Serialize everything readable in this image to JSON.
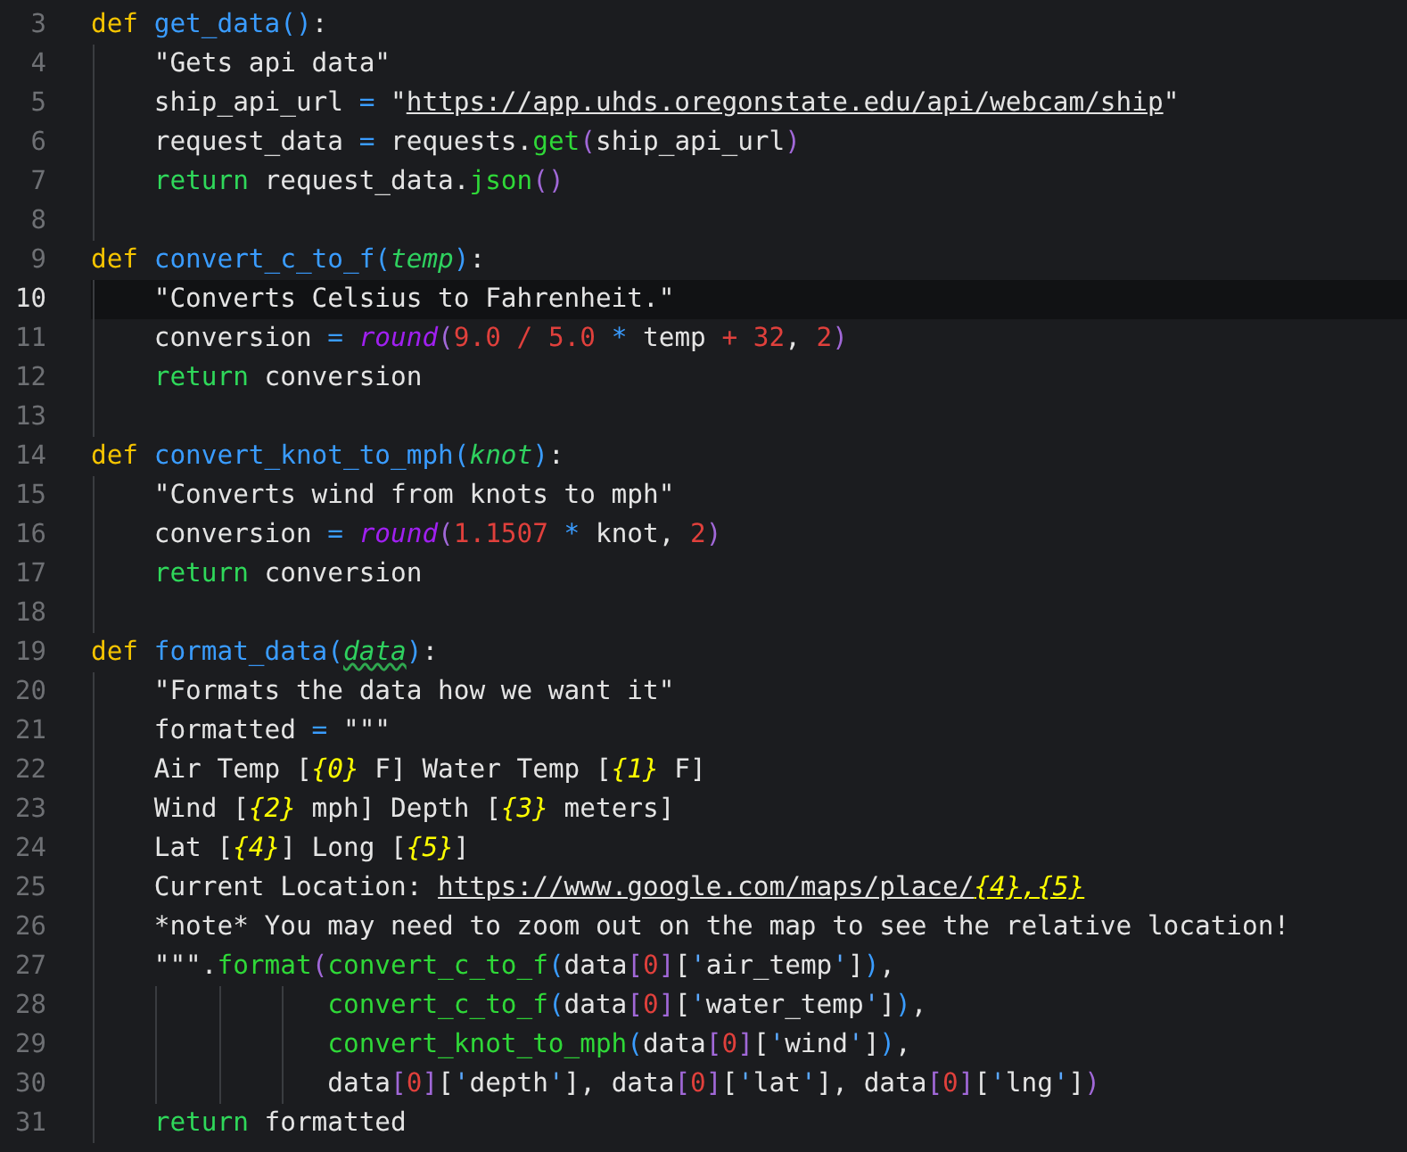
{
  "editor": {
    "lines": [
      {
        "number": "3",
        "current": false,
        "tokens": [
          {
            "kind": "keyword",
            "text": "def "
          },
          {
            "kind": "function",
            "text": "get_data"
          },
          {
            "kind": "paren",
            "text": "()"
          },
          {
            "kind": "plain",
            "text": ":"
          }
        ]
      },
      {
        "number": "4",
        "current": false,
        "tokens": [
          {
            "kind": "string",
            "text": "    \"Gets api data\""
          }
        ]
      },
      {
        "number": "5",
        "current": false,
        "tokens": [
          {
            "kind": "plain",
            "text": "    ship_api_url "
          },
          {
            "kind": "operator",
            "text": "="
          },
          {
            "kind": "string",
            "text": " \""
          },
          {
            "kind": "link",
            "text": "https://app.uhds.oregonstate.edu/api/webcam/ship"
          },
          {
            "kind": "string",
            "text": "\""
          }
        ]
      },
      {
        "number": "6",
        "current": false,
        "tokens": [
          {
            "kind": "plain",
            "text": "    request_data "
          },
          {
            "kind": "operator",
            "text": "="
          },
          {
            "kind": "plain",
            "text": " requests."
          },
          {
            "kind": "method",
            "text": "get"
          },
          {
            "kind": "bracket",
            "text": "("
          },
          {
            "kind": "plain",
            "text": "ship_api_url"
          },
          {
            "kind": "bracket",
            "text": ")"
          }
        ]
      },
      {
        "number": "7",
        "current": false,
        "tokens": [
          {
            "kind": "return",
            "text": "    return"
          },
          {
            "kind": "plain",
            "text": " request_data."
          },
          {
            "kind": "method",
            "text": "json"
          },
          {
            "kind": "bracket",
            "text": "()"
          }
        ]
      },
      {
        "number": "8",
        "current": false
      },
      {
        "number": "9",
        "current": false,
        "tokens": [
          {
            "kind": "keyword",
            "text": "def "
          },
          {
            "kind": "function",
            "text": "convert_c_to_f"
          },
          {
            "kind": "paren",
            "text": "("
          },
          {
            "kind": "param",
            "text": "temp"
          },
          {
            "kind": "paren",
            "text": ")"
          },
          {
            "kind": "plain",
            "text": ":"
          }
        ]
      },
      {
        "number": "10",
        "current": true,
        "tokens": [
          {
            "kind": "string",
            "text": "    \"Converts Celsius to Fahrenheit.\""
          }
        ]
      },
      {
        "number": "11",
        "current": false,
        "tokens": [
          {
            "kind": "plain",
            "text": "    conversion "
          },
          {
            "kind": "operator",
            "text": "="
          },
          {
            "kind": "builtin",
            "text": " round"
          },
          {
            "kind": "bracket",
            "text": "("
          },
          {
            "kind": "number",
            "text": "9.0 / 5.0"
          },
          {
            "kind": "operator",
            "text": " *"
          },
          {
            "kind": "plain",
            "text": " temp "
          },
          {
            "kind": "number",
            "text": "+ 32"
          },
          {
            "kind": "plain",
            "text": ", "
          },
          {
            "kind": "number",
            "text": "2"
          },
          {
            "kind": "bracket",
            "text": ")"
          }
        ]
      },
      {
        "number": "12",
        "current": false,
        "tokens": [
          {
            "kind": "return",
            "text": "    return"
          },
          {
            "kind": "plain",
            "text": " conversion"
          }
        ]
      },
      {
        "number": "13",
        "current": false
      },
      {
        "number": "14",
        "current": false,
        "tokens": [
          {
            "kind": "keyword",
            "text": "def "
          },
          {
            "kind": "function",
            "text": "convert_knot_to_mph"
          },
          {
            "kind": "paren",
            "text": "("
          },
          {
            "kind": "param",
            "text": "knot"
          },
          {
            "kind": "paren",
            "text": ")"
          },
          {
            "kind": "plain",
            "text": ":"
          }
        ]
      },
      {
        "number": "15",
        "current": false,
        "tokens": [
          {
            "kind": "string",
            "text": "    \"Converts wind from knots to mph\""
          }
        ]
      },
      {
        "number": "16",
        "current": false,
        "tokens": [
          {
            "kind": "plain",
            "text": "    conversion "
          },
          {
            "kind": "operator",
            "text": "="
          },
          {
            "kind": "builtin",
            "text": " round"
          },
          {
            "kind": "bracket",
            "text": "("
          },
          {
            "kind": "number",
            "text": "1.1507"
          },
          {
            "kind": "operator",
            "text": " *"
          },
          {
            "kind": "plain",
            "text": " knot, "
          },
          {
            "kind": "number",
            "text": "2"
          },
          {
            "kind": "bracket",
            "text": ")"
          }
        ]
      },
      {
        "number": "17",
        "current": false,
        "tokens": [
          {
            "kind": "return",
            "text": "    return"
          },
          {
            "kind": "plain",
            "text": " conversion"
          }
        ]
      },
      {
        "number": "18",
        "current": false
      },
      {
        "number": "19",
        "current": false,
        "tokens": [
          {
            "kind": "keyword",
            "text": "def "
          },
          {
            "kind": "function",
            "text": "format_data"
          },
          {
            "kind": "paren",
            "text": "("
          },
          {
            "kind": "param-warning",
            "text": "data"
          },
          {
            "kind": "paren",
            "text": ")"
          },
          {
            "kind": "plain",
            "text": ":"
          }
        ]
      },
      {
        "number": "20",
        "current": false,
        "tokens": [
          {
            "kind": "string",
            "text": "    \"Formats the data how we want it\""
          }
        ]
      },
      {
        "number": "21",
        "current": false,
        "tokens": [
          {
            "kind": "plain",
            "text": "    formatted "
          },
          {
            "kind": "operator",
            "text": "="
          },
          {
            "kind": "string",
            "text": " \"\"\""
          }
        ]
      },
      {
        "number": "22",
        "current": false,
        "tokens": [
          {
            "kind": "plain",
            "text": "    Air Temp ["
          },
          {
            "kind": "placeholder",
            "text": "{0}"
          },
          {
            "kind": "plain",
            "text": " F] Water Temp ["
          },
          {
            "kind": "placeholder",
            "text": "{1}"
          },
          {
            "kind": "plain",
            "text": " F]"
          }
        ]
      },
      {
        "number": "23",
        "current": false,
        "tokens": [
          {
            "kind": "plain",
            "text": "    Wind ["
          },
          {
            "kind": "placeholder",
            "text": "{2}"
          },
          {
            "kind": "plain",
            "text": " mph] Depth ["
          },
          {
            "kind": "placeholder",
            "text": "{3}"
          },
          {
            "kind": "plain",
            "text": " meters]"
          }
        ]
      },
      {
        "number": "24",
        "current": false,
        "tokens": [
          {
            "kind": "plain",
            "text": "    Lat ["
          },
          {
            "kind": "placeholder",
            "text": "{4}"
          },
          {
            "kind": "plain",
            "text": "] Long ["
          },
          {
            "kind": "placeholder",
            "text": "{5}"
          },
          {
            "kind": "plain",
            "text": "]"
          }
        ]
      },
      {
        "number": "25",
        "current": false,
        "tokens": [
          {
            "kind": "plain",
            "text": "    Current Location: "
          },
          {
            "kind": "link",
            "text": "https://www.google.com/maps/place/"
          },
          {
            "kind": "link-placeholder",
            "text": "{4},{5}"
          }
        ]
      },
      {
        "number": "26",
        "current": false,
        "tokens": [
          {
            "kind": "plain",
            "text": "    *note* You may need to zoom out on the map to see the relative location!"
          }
        ]
      },
      {
        "number": "27",
        "current": false,
        "tokens": [
          {
            "kind": "plain",
            "text": "    \"\"\"."
          },
          {
            "kind": "method",
            "text": "format"
          },
          {
            "kind": "bracket",
            "text": "("
          },
          {
            "kind": "method",
            "text": "convert_c_to_f"
          },
          {
            "kind": "paren",
            "text": "("
          },
          {
            "kind": "plain",
            "text": "data"
          },
          {
            "kind": "bracket",
            "text": "["
          },
          {
            "kind": "number",
            "text": "0"
          },
          {
            "kind": "bracket",
            "text": "]"
          },
          {
            "kind": "plain",
            "text": "["
          },
          {
            "kind": "quote",
            "text": "'"
          },
          {
            "kind": "plain",
            "text": "air_temp"
          },
          {
            "kind": "quote",
            "text": "'"
          },
          {
            "kind": "plain",
            "text": "]"
          },
          {
            "kind": "paren",
            "text": ")"
          },
          {
            "kind": "plain",
            "text": ","
          }
        ]
      },
      {
        "number": "28",
        "current": false,
        "tokens": [
          {
            "kind": "method",
            "text": "               convert_c_to_f"
          },
          {
            "kind": "paren",
            "text": "("
          },
          {
            "kind": "plain",
            "text": "data"
          },
          {
            "kind": "bracket",
            "text": "["
          },
          {
            "kind": "number",
            "text": "0"
          },
          {
            "kind": "bracket",
            "text": "]"
          },
          {
            "kind": "plain",
            "text": "["
          },
          {
            "kind": "quote",
            "text": "'"
          },
          {
            "kind": "plain",
            "text": "water_temp"
          },
          {
            "kind": "quote",
            "text": "'"
          },
          {
            "kind": "plain",
            "text": "]"
          },
          {
            "kind": "paren",
            "text": ")"
          },
          {
            "kind": "plain",
            "text": ","
          }
        ]
      },
      {
        "number": "29",
        "current": false,
        "tokens": [
          {
            "kind": "method",
            "text": "               convert_knot_to_mph"
          },
          {
            "kind": "paren",
            "text": "("
          },
          {
            "kind": "plain",
            "text": "data"
          },
          {
            "kind": "bracket",
            "text": "["
          },
          {
            "kind": "number",
            "text": "0"
          },
          {
            "kind": "bracket",
            "text": "]"
          },
          {
            "kind": "plain",
            "text": "["
          },
          {
            "kind": "quote",
            "text": "'"
          },
          {
            "kind": "plain",
            "text": "wind"
          },
          {
            "kind": "quote",
            "text": "'"
          },
          {
            "kind": "plain",
            "text": "]"
          },
          {
            "kind": "paren",
            "text": ")"
          },
          {
            "kind": "plain",
            "text": ","
          }
        ]
      },
      {
        "number": "30",
        "current": false,
        "tokens": [
          {
            "kind": "plain",
            "text": "               data"
          },
          {
            "kind": "bracket",
            "text": "["
          },
          {
            "kind": "number",
            "text": "0"
          },
          {
            "kind": "bracket",
            "text": "]"
          },
          {
            "kind": "plain",
            "text": "["
          },
          {
            "kind": "quote",
            "text": "'"
          },
          {
            "kind": "plain",
            "text": "depth"
          },
          {
            "kind": "quote",
            "text": "'"
          },
          {
            "kind": "plain",
            "text": "], data"
          },
          {
            "kind": "bracket",
            "text": "["
          },
          {
            "kind": "number",
            "text": "0"
          },
          {
            "kind": "bracket",
            "text": "]"
          },
          {
            "kind": "plain",
            "text": "["
          },
          {
            "kind": "quote",
            "text": "'"
          },
          {
            "kind": "plain",
            "text": "lat"
          },
          {
            "kind": "quote",
            "text": "'"
          },
          {
            "kind": "plain",
            "text": "], data"
          },
          {
            "kind": "bracket",
            "text": "["
          },
          {
            "kind": "number",
            "text": "0"
          },
          {
            "kind": "bracket",
            "text": "]"
          },
          {
            "kind": "plain",
            "text": "["
          },
          {
            "kind": "quote",
            "text": "'"
          },
          {
            "kind": "plain",
            "text": "lng"
          },
          {
            "kind": "quote",
            "text": "'"
          },
          {
            "kind": "plain",
            "text": "]"
          },
          {
            "kind": "bracket",
            "text": ")"
          }
        ]
      },
      {
        "number": "31",
        "current": false,
        "tokens": [
          {
            "kind": "return",
            "text": "    return"
          },
          {
            "kind": "plain",
            "text": " formatted"
          }
        ]
      }
    ]
  }
}
